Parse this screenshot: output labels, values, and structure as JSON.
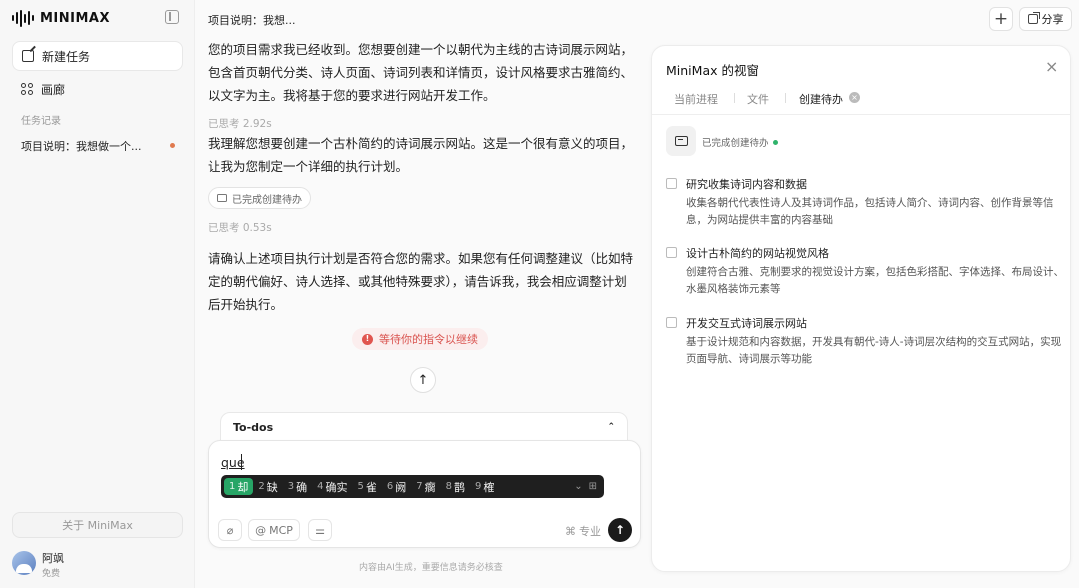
{
  "app": {
    "logo_text": "MINIMAX"
  },
  "sidebar": {
    "new_task": "新建任务",
    "gallery": "画廊",
    "history_label": "任务记录",
    "history_items": [
      {
        "label": "项目说明：我想做一个..."
      }
    ],
    "about": "关于 MiniMax",
    "user": {
      "name": "阿飒",
      "plan": "免费"
    }
  },
  "header": {
    "title": "项目说明：我想...",
    "share": "分享"
  },
  "chat": {
    "message_1": "您的项目需求我已经收到。您想要创建一个以朝代为主线的古诗词展示网站，包含首页朝代分类、诗人页面、诗词列表和详情页，设计风格要求古雅简约、以文字为主。我将基于您的要求进行网站开发工作。",
    "thought_1": "已思考 2.92s",
    "message_2": "我理解您想要创建一个古朴简约的诗词展示网站。这是一个很有意义的项目，让我为您制定一个详细的执行计划。",
    "chip": "已完成创建待办",
    "thought_2": "已思考 0.53s",
    "message_3": "请确认上述项目执行计划是否符合您的需求。如果您有任何调整建议（比如特定的朝代偏好、诗人选择、或其他特殊要求），请告诉我，我会相应调整计划后开始执行。",
    "waiting": "等待你的指令以继续",
    "footer_note": "内容由AI生成，重要信息请务必核查"
  },
  "composer": {
    "todos_label": "To-dos",
    "input_text": "que",
    "ime_candidates": [
      {
        "n": "1",
        "text": "却"
      },
      {
        "n": "2",
        "text": "缺"
      },
      {
        "n": "3",
        "text": "确"
      },
      {
        "n": "4",
        "text": "确实"
      },
      {
        "n": "5",
        "text": "雀"
      },
      {
        "n": "6",
        "text": "阙"
      },
      {
        "n": "7",
        "text": "瘸"
      },
      {
        "n": "8",
        "text": "鹊"
      },
      {
        "n": "9",
        "text": "榷"
      }
    ],
    "mcp": "MCP",
    "mode": "专业"
  },
  "panel": {
    "title": "MiniMax 的视窗",
    "tabs": [
      "当前进程",
      "文件",
      "创建待办"
    ],
    "status": "已完成创建待办",
    "todos": [
      {
        "title": "研究收集诗词内容和数据",
        "desc": "收集各朝代代表性诗人及其诗词作品，包括诗人简介、诗词内容、创作背景等信息，为网站提供丰富的内容基础"
      },
      {
        "title": "设计古朴简约的网站视觉风格",
        "desc": "创建符合古雅、克制要求的视觉设计方案，包括色彩搭配、字体选择、布局设计、水墨风格装饰元素等"
      },
      {
        "title": "开发交互式诗词展示网站",
        "desc": "基于设计规范和内容数据，开发具有朝代-诗人-诗词层次结构的交互式网站，实现页面导航、诗词展示等功能"
      }
    ]
  },
  "colors": {
    "accent_green": "#27a566",
    "warning_red": "#d9534f",
    "status_green": "#2fb36b"
  }
}
